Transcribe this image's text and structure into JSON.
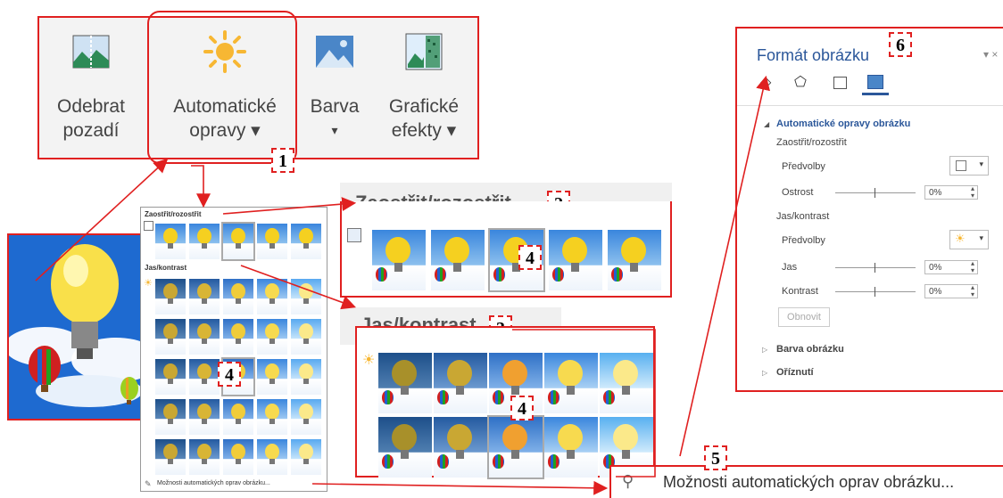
{
  "ribbon": {
    "buttons": [
      {
        "line1": "Odebrat",
        "line2": "pozadí",
        "icon": "remove-background-icon"
      },
      {
        "line1": "Automatické",
        "line2": "opravy ▾",
        "icon": "sun-icon"
      },
      {
        "line1": "Barva",
        "line2": "▾",
        "icon": "picture-color-icon"
      },
      {
        "line1": "Grafické",
        "line2": "efekty ▾",
        "icon": "artistic-effects-icon"
      }
    ]
  },
  "tags": {
    "t1": "1",
    "t2": "2",
    "t3": "3",
    "t4": "4",
    "t5": "5",
    "t6": "6"
  },
  "gallery": {
    "section1": "Zaostřit/rozostřit",
    "section2": "Jas/kontrast",
    "footer": "Možnosti automatických oprav obrázku..."
  },
  "zoom_sharpen": {
    "title": "Zaostřit/rozostřit"
  },
  "zoom_brightness": {
    "title": "Jas/kontrast"
  },
  "auto_options": {
    "label": "Možnosti automatických oprav obrázku..."
  },
  "format_pane": {
    "title": "Formát obrázku",
    "section_expanded": "Automatické opravy obrázku",
    "sharpen_heading": "Zaostřit/rozostřit",
    "presets1": "Předvolby",
    "sharpness": "Ostrost",
    "sharpness_value": "0%",
    "brightness_heading": "Jas/kontrast",
    "presets2": "Předvolby",
    "brightness": "Jas",
    "brightness_value": "0%",
    "contrast": "Kontrast",
    "contrast_value": "0%",
    "reset": "Obnovit",
    "section_color": "Barva obrázku",
    "section_crop": "Oříznutí"
  },
  "colors": {
    "accent": "#e02020",
    "office_blue": "#2b579a",
    "sky": "#1e6ad0",
    "bulb": "#f5d020"
  }
}
